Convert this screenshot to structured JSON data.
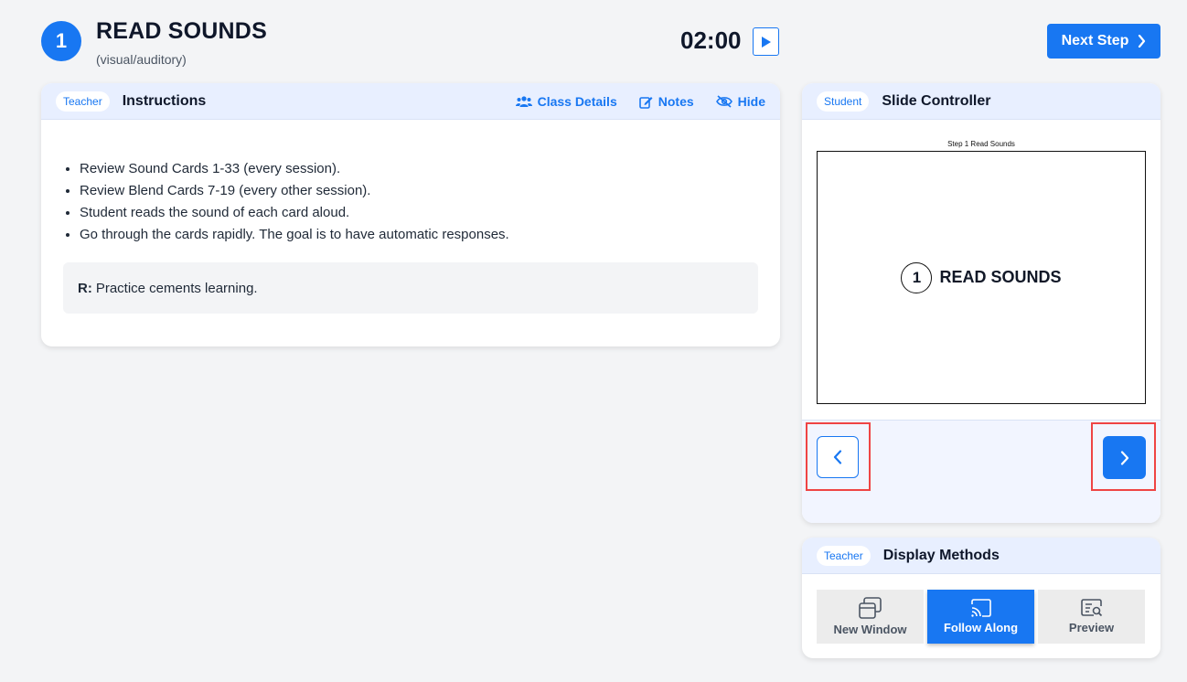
{
  "header": {
    "step_number": "1",
    "title": "READ SOUNDS",
    "subtitle": "(visual/auditory)",
    "timer": "02:00",
    "next_step_label": "Next Step"
  },
  "instructions": {
    "badge": "Teacher",
    "title": "Instructions",
    "actions": [
      "Class Details",
      "Notes",
      "Hide"
    ],
    "items": [
      "Review Sound Cards 1-33 (every session).",
      "Review Blend Cards 7-19 (every other session).",
      "Student reads the sound of each card aloud.",
      "Go through the cards rapidly. The goal is to have automatic responses."
    ],
    "reason_label": "R:",
    "reason_text": "Practice cements learning."
  },
  "slide_controller": {
    "badge": "Student",
    "title": "Slide Controller",
    "slide_caption": "Step 1 Read Sounds",
    "slide_number": "1",
    "slide_title": "READ SOUNDS"
  },
  "display_methods": {
    "badge": "Teacher",
    "title": "Display Methods",
    "methods": [
      "New Window",
      "Follow Along",
      "Preview"
    ],
    "active": "Follow Along"
  },
  "colors": {
    "accent": "#1877f2",
    "highlight": "#ef4444",
    "background": "#f3f4f6"
  }
}
